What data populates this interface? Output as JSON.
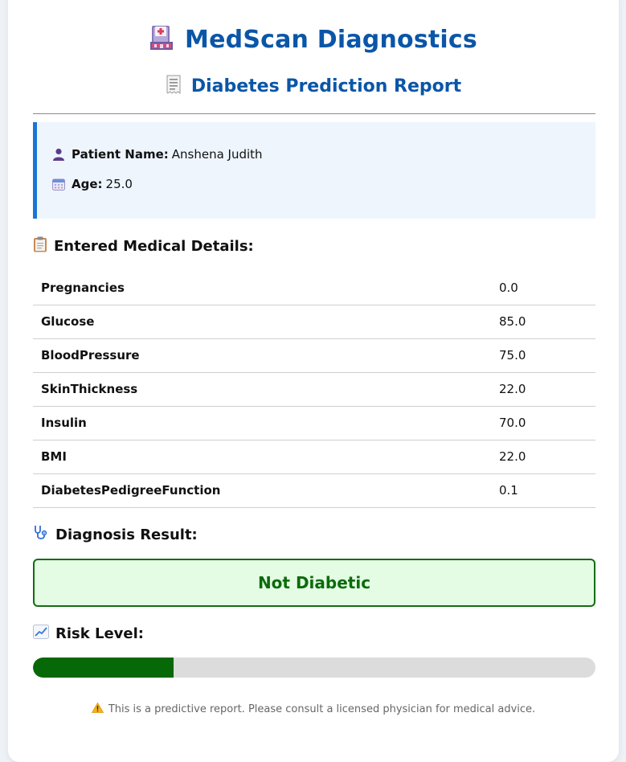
{
  "header": {
    "title": "MedScan Diagnostics",
    "title_icon": "hospital-icon",
    "subtitle": "Diabetes Prediction Report",
    "subtitle_icon": "receipt-icon"
  },
  "patient": {
    "name_label": "Patient Name:",
    "name_value": "Anshena Judith",
    "name_icon": "person-icon",
    "age_label": "Age:",
    "age_value": "25.0",
    "age_icon": "calendar-icon"
  },
  "details": {
    "heading": "Entered Medical Details:",
    "heading_icon": "clipboard-icon",
    "rows": [
      {
        "label": "Pregnancies",
        "value": "0.0"
      },
      {
        "label": "Glucose",
        "value": "85.0"
      },
      {
        "label": "BloodPressure",
        "value": "75.0"
      },
      {
        "label": "SkinThickness",
        "value": "22.0"
      },
      {
        "label": "Insulin",
        "value": "70.0"
      },
      {
        "label": "BMI",
        "value": "22.0"
      },
      {
        "label": "DiabetesPedigreeFunction",
        "value": "0.1"
      }
    ]
  },
  "diagnosis": {
    "heading": "Diagnosis Result:",
    "heading_icon": "stethoscope-icon",
    "result": "Not Diabetic",
    "result_color": "#0b6b0b"
  },
  "risk": {
    "heading": "Risk Level:",
    "heading_icon": "chart-increasing-icon",
    "level_fraction": 0.25,
    "fill_color": "#066806"
  },
  "footer": {
    "disclaimer": "This is a predictive report. Please consult a licensed physician for medical advice.",
    "disclaimer_icon": "warning-icon"
  }
}
